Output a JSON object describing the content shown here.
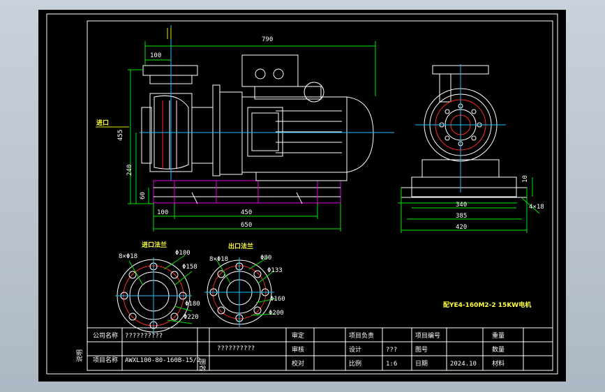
{
  "dimensions": {
    "overall_length": "790",
    "inlet_offset": "100",
    "height": "455",
    "lower_height": "240",
    "base_height": "60",
    "base_left": "100",
    "base_span": "450",
    "base_total": "650",
    "side_340": "340",
    "side_385": "385",
    "side_420": "420",
    "side_10": "10",
    "side_holes": "4×18"
  },
  "labels": {
    "inlet_arrow": "进口",
    "inlet_flange_title": "进口法兰",
    "outlet_flange_title": "出口法兰",
    "motor_label": "配YE4-160M2-2 15KW电机"
  },
  "inlet_flange": {
    "bolt_holes": "8×Φ18",
    "d1": "Φ100",
    "d2": "Φ158",
    "d3": "Φ180",
    "d4": "Φ220"
  },
  "outlet_flange": {
    "bolt_holes": "8×Φ18",
    "d1": "Φ80",
    "d2": "Φ133",
    "d3": "Φ160",
    "d4": "Φ200"
  },
  "title_block": {
    "company_label": "公司名称",
    "company_value": "??????????",
    "project_label": "项目名称",
    "project_value": "AWXL100-80-160B-15/2",
    "drawing_label": "图名",
    "drawing_value": "??????????",
    "side_mark": "说明",
    "r1": [
      "审定",
      "",
      "项目负责",
      "",
      "项目编号",
      "",
      "重量",
      ""
    ],
    "r2": [
      "审核",
      "",
      "设计",
      "???",
      "图号",
      "",
      "数量",
      ""
    ],
    "r3": [
      "校对",
      "",
      "比例",
      "1:6",
      "日期",
      "2024.10",
      "材料",
      ""
    ]
  }
}
